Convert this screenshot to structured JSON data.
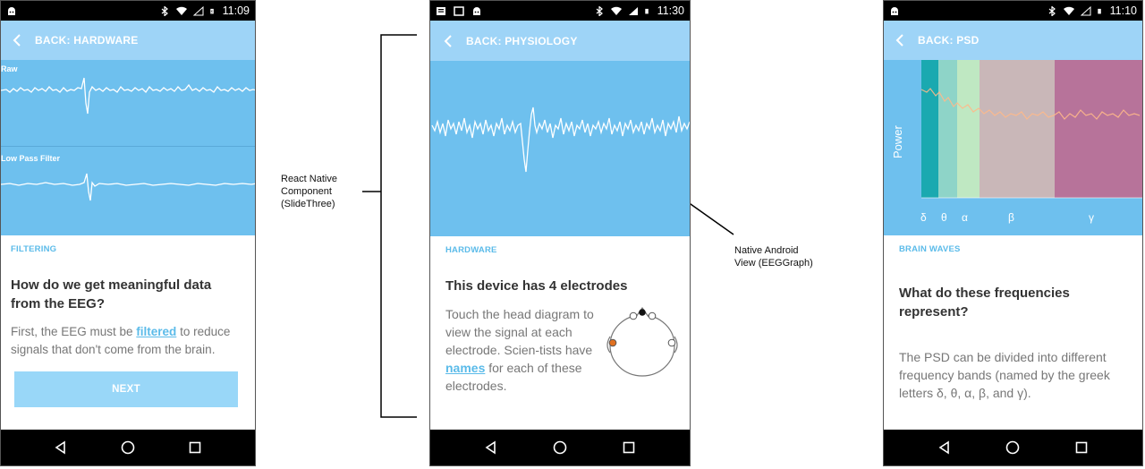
{
  "screen1": {
    "status_time": "11:09",
    "back_label": "BACK: HARDWARE",
    "graph1_label": "Raw",
    "graph2_label": "Low Pass Filter",
    "section_label": "FILTERING",
    "heading": "How do we get meaningful data from the EEG?",
    "body_pre": "First, the EEG must be ",
    "body_link": "filtered",
    "body_post": " to reduce signals that don't come from the brain.",
    "button_label": "NEXT"
  },
  "screen2": {
    "status_time": "11:30",
    "back_label": "BACK: PHYSIOLOGY",
    "section_label": "HARDWARE",
    "heading": "This device has 4 electrodes",
    "body_pre": "Touch the head diagram to view the signal at each electrode. Scien-tists have ",
    "body_link": "names",
    "body_post": " for each of these electrodes."
  },
  "screen3": {
    "status_time": "11:10",
    "back_label": "BACK: PSD",
    "y_label": "Power",
    "bands": [
      "δ",
      "θ",
      "α",
      "β",
      "γ"
    ],
    "band_colors": [
      "#1aa9b0",
      "#8ed4c8",
      "#bfe8c2",
      "#c9b7b8",
      "#b7739a"
    ],
    "section_label": "BRAIN WAVES",
    "heading": "What do these frequencies represent?",
    "body": "The PSD can be divided into different frequency bands (named by the greek letters δ, θ, α, β, and γ)."
  },
  "annotations": {
    "left": "React Native\nComponent\n(SlideThree)",
    "right": "Native Android\nView (EEGGraph)"
  },
  "colors": {
    "app_bar": "#9ed4f7",
    "graph_bg": "#6ec0ee",
    "accent": "#5bbbe9"
  }
}
